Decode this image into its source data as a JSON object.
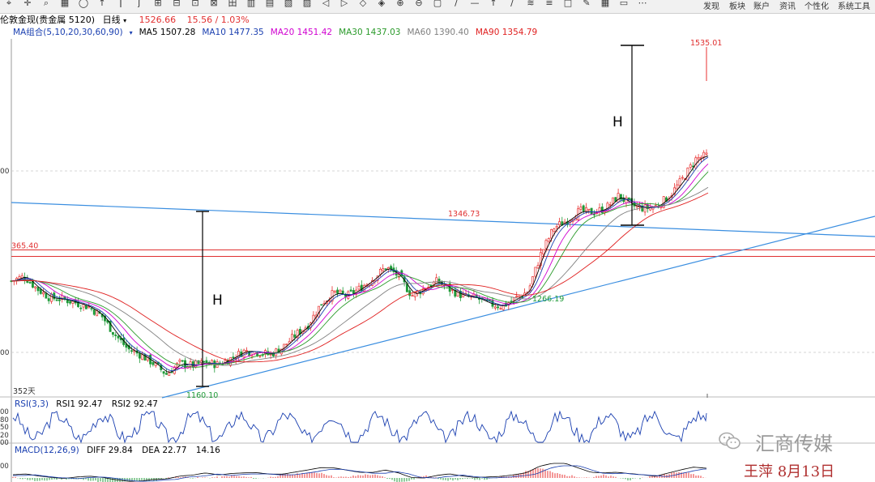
{
  "toolbar": {
    "icons": [
      "cursor-icon",
      "crosshair-icon",
      "magnify-icon",
      "grid-icon",
      "circle-icon",
      "draw-icon",
      "text-icon",
      "tick-icon",
      "tf-1min-icon",
      "tf-5min-icon",
      "tf-15min-icon",
      "tf-60min-icon",
      "day-icon",
      "week-icon",
      "month-icon",
      "quarter-icon",
      "year-icon",
      "rewind-icon",
      "forward-icon",
      "left-icon",
      "right-icon",
      "zoom-in-icon",
      "zoom-out-icon",
      "box-icon",
      "line-icon",
      "hline-icon",
      "vline-icon",
      "ray-icon",
      "channel-icon",
      "fib-icon",
      "square-icon",
      "note-icon",
      "grid2-icon",
      "window-icon",
      "more-icon"
    ],
    "right_items": [
      "发现",
      "板块",
      "账户",
      "资讯",
      "个性化",
      "系统工具"
    ]
  },
  "info": {
    "symbol": "伦敦金现(贵金属 5120)",
    "period": "日线",
    "price": "1526.66",
    "change": "15.56 / 1.03%",
    "price_color": "#e23030"
  },
  "ma_bar": [
    {
      "text": "MA组合(5,10,20,30,60,90)",
      "color": "#1a3fb0"
    },
    {
      "text": "MA5 1507.28",
      "color": "#000000"
    },
    {
      "text": "MA10 1477.35",
      "color": "#1a3fb0"
    },
    {
      "text": "MA20 1451.42",
      "color": "#d000d0"
    },
    {
      "text": "MA30 1437.03",
      "color": "#2a9a2a"
    },
    {
      "text": "MA60 1390.40",
      "color": "#808080"
    },
    {
      "text": "MA90 1354.79",
      "color": "#e02020"
    }
  ],
  "annotations": {
    "high": "1535.01",
    "peak": "1346.73",
    "low1": "1160.10",
    "low2": "1266.19",
    "resistance": "365.40",
    "h_left": "H",
    "h_right": "H",
    "days": "352天",
    "y_axis_upper": "00",
    "y_axis_lower": "00"
  },
  "rsi": {
    "label": "RSI(3,3)",
    "rsi1": "RSI1 92.47",
    "rsi2": "RSI2 92.47",
    "ticks": [
      "00",
      "80",
      "50",
      "20",
      "00"
    ]
  },
  "macd": {
    "label": "MACD(12,26,9)",
    "diff": "DIFF 29.84",
    "dea": "DEA 22.77",
    "value": "14.16",
    "tick": "00"
  },
  "watermark": "汇商传媒",
  "author": "王萍 8月13日",
  "chart_data": {
    "type": "candlestick",
    "instrument": "伦敦金现",
    "ma_series": [
      {
        "name": "MA5",
        "value": 1507.28,
        "color": "#000000"
      },
      {
        "name": "MA10",
        "value": 1477.35,
        "color": "#1a3fb0"
      },
      {
        "name": "MA20",
        "value": 1451.42,
        "color": "#d000d0"
      },
      {
        "name": "MA30",
        "value": 1437.03,
        "color": "#2a9a2a"
      },
      {
        "name": "MA60",
        "value": 1390.4,
        "color": "#808080"
      },
      {
        "name": "MA90",
        "value": 1354.79,
        "color": "#e02020"
      }
    ],
    "x": [
      0,
      20,
      40,
      60,
      80,
      100,
      120,
      140,
      160,
      180,
      200,
      220,
      240,
      260,
      280,
      300,
      320,
      340,
      360,
      380,
      400,
      420,
      440,
      460,
      480,
      500,
      520,
      540,
      560,
      580,
      600,
      620,
      640,
      660,
      680,
      700,
      720,
      740,
      760,
      780,
      800,
      820,
      840,
      860,
      880,
      900,
      920,
      940,
      960,
      980,
      1000,
      1020,
      1040,
      1060,
      1080
    ],
    "close": [
      1318,
      1326,
      1305,
      1290,
      1288,
      1282,
      1275,
      1260,
      1230,
      1206,
      1196,
      1182,
      1164,
      1182,
      1178,
      1183,
      1180,
      1190,
      1202,
      1201,
      1196,
      1208,
      1229,
      1246,
      1281,
      1299,
      1293,
      1306,
      1322,
      1341,
      1326,
      1294,
      1306,
      1318,
      1303,
      1293,
      1290,
      1280,
      1276,
      1289,
      1301,
      1363,
      1406,
      1418,
      1434,
      1431,
      1438,
      1459,
      1443,
      1438,
      1442,
      1460,
      1488,
      1520,
      1526.66
    ],
    "levels": {
      "high": 1535.01,
      "peak": 1346.73,
      "low_1": 1160.1,
      "low_2": 1266.19
    },
    "rsi_last": 92.47,
    "macd": {
      "diff": 29.84,
      "dea": 22.77,
      "macd": 14.16
    }
  }
}
